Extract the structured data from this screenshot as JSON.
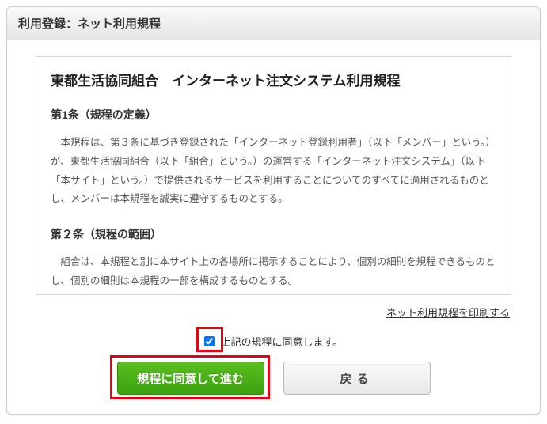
{
  "titlebar": "利用登録：ネット利用規程",
  "terms": {
    "heading": "東都生活協同組合　インターネット注文システム利用規程",
    "article1_title": "第1条（規程の定義）",
    "article1_body": "本規程は、第３条に基づき登録された「インターネット登録利用者」（以下「メンバー」という。）が、東都生活協同組合（以下「組合」という。）の運営する「インターネット注文システム」（以下「本サイト」という。）で提供されるサービスを利用することについてのすべてに適用されるものとし、メンバーは本規程を誠実に遵守するものとする。",
    "article2_title": "第２条（規程の範囲）",
    "article2_body": "組合は、本規程と別に本サイト上の各場所に掲示することにより、個別の細則を規程できるものとし、個別の細則は本規程の一部を構成するものとする。"
  },
  "print_link": "ネット利用規程を印刷する",
  "agree_label": "上記の規程に同意します。",
  "buttons": {
    "primary": "規程に同意して進む",
    "secondary": "戻る"
  }
}
